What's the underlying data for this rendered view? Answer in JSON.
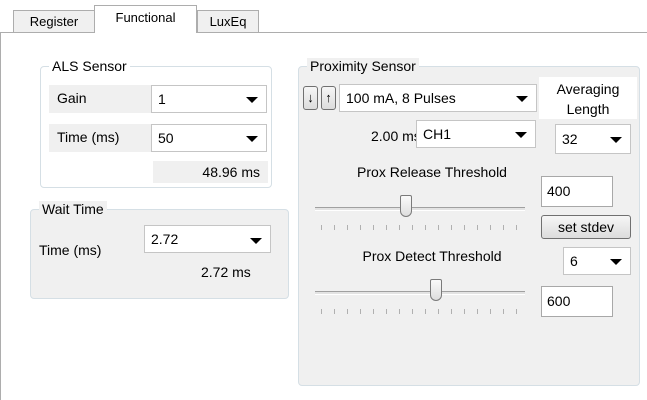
{
  "tabs": [
    {
      "label": "Register",
      "active": false
    },
    {
      "label": "Functional",
      "active": true
    },
    {
      "label": "LuxEq",
      "active": false
    }
  ],
  "als_sensor": {
    "title": "ALS Sensor",
    "gain_label": "Gain",
    "gain_value": "1",
    "time_label": "Time (ms)",
    "time_value": "50",
    "time_readout": "48.96 ms"
  },
  "wait_time": {
    "title": "Wait Time",
    "time_label": "Time (ms)",
    "time_value": "2.72",
    "time_readout": "2.72 ms"
  },
  "proximity": {
    "title": "Proximity Sensor",
    "down_arrow": "↓",
    "up_arrow": "↑",
    "pulse_value": "100 mA, 8 Pulses",
    "time_readout": "2.00 ms",
    "channel_value": "CH1",
    "averaging_label_line1": "Averaging",
    "averaging_label_line2": "Length",
    "averaging_value": "32",
    "release_label": "Prox Release Threshold",
    "release_value": "400",
    "release_level": 0.43,
    "set_stdev_label": "set stdev",
    "stdev_value": "6",
    "detect_label": "Prox Detect Threshold",
    "detect_value": "600",
    "detect_level": 0.58
  }
}
